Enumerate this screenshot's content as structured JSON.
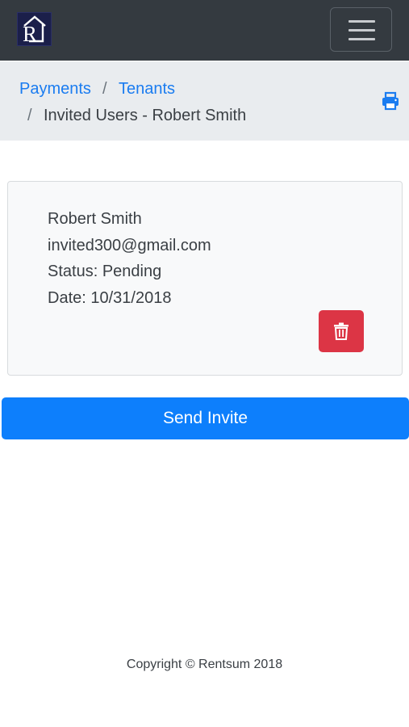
{
  "app": {
    "brand_letter": "R"
  },
  "breadcrumb": {
    "items": [
      {
        "label": "Payments"
      },
      {
        "label": "Tenants"
      },
      {
        "label": "Invited Users - Robert Smith"
      }
    ],
    "separator": "/"
  },
  "invite": {
    "name": "Robert Smith",
    "email": "invited300@gmail.com",
    "status": "Status: Pending",
    "date": "Date: 10/31/2018"
  },
  "actions": {
    "send_invite_label": "Send Invite"
  },
  "footer": {
    "copyright": "Copyright © Rentsum 2018"
  },
  "icons": {
    "menu": "hamburger-icon",
    "print": "print-icon",
    "delete": "trash-icon"
  },
  "colors": {
    "navbar": "#343a40",
    "link": "#1a7cf0",
    "danger": "#dc3545",
    "primary": "#0d7ffc",
    "breadcrumb_bg": "#e9ecef"
  }
}
